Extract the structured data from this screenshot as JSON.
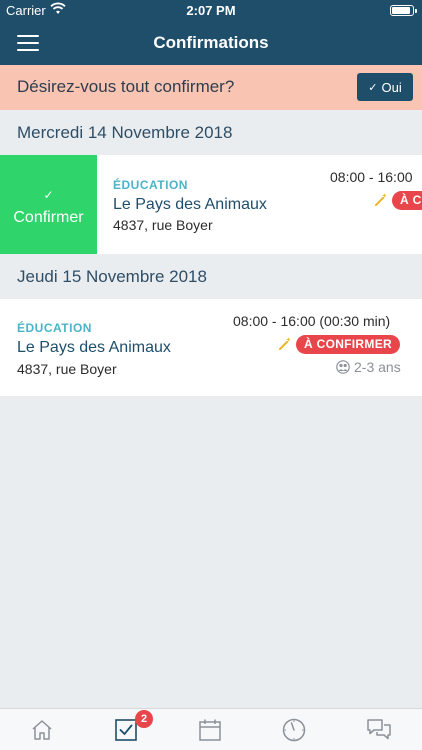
{
  "status": {
    "carrier": "Carrier",
    "time": "2:07 PM"
  },
  "nav": {
    "title": "Confirmations",
    "menu_icon": "hamburger-menu-icon"
  },
  "banner": {
    "question": "Désirez-vous tout confirmer?",
    "button_label": "Oui",
    "button_icon": "check-icon"
  },
  "groups": [
    {
      "date": "Mercredi 14 Novembre 2018",
      "swipe_action": {
        "label": "Confirmer",
        "icon": "check-icon"
      },
      "shift": {
        "category": "ÉDUCATION",
        "name": "Le Pays des Animaux",
        "address": "4837, rue Boyer",
        "hours": "08:00 - 16:00",
        "status": "À C"
      }
    },
    {
      "date": "Jeudi 15 Novembre 2018",
      "shift": {
        "category": "ÉDUCATION",
        "name": "Le Pays des Animaux",
        "address": "4837, rue Boyer",
        "hours": "08:00 - 16:00 (00:30 min)",
        "status": "À CONFIRMER",
        "age_group": "2-3 ans"
      }
    }
  ],
  "tabs": [
    {
      "name": "home",
      "icon": "home-icon"
    },
    {
      "name": "confirmations",
      "icon": "checkbox-icon",
      "badge": "2",
      "active": true
    },
    {
      "name": "calendar",
      "icon": "calendar-icon"
    },
    {
      "name": "clock",
      "icon": "clock-icon"
    },
    {
      "name": "messages",
      "icon": "chat-icon"
    }
  ],
  "colors": {
    "primary": "#1f4e6b",
    "banner": "#f9c4b1",
    "confirm_green": "#2fd46b",
    "badge_red": "#e8464b",
    "category_teal": "#4ab4c8",
    "background": "#e9edf0"
  }
}
